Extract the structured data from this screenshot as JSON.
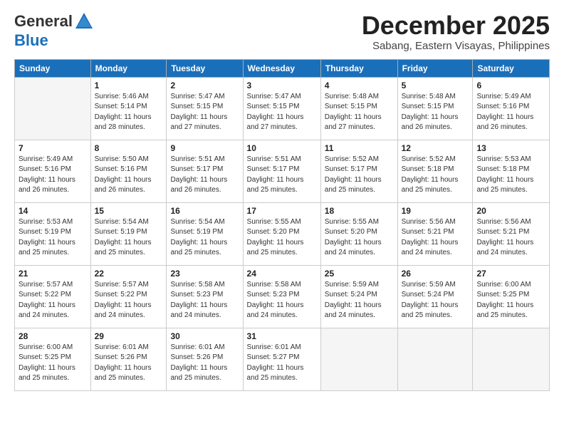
{
  "header": {
    "logo_general": "General",
    "logo_blue": "Blue",
    "month_title": "December 2025",
    "subtitle": "Sabang, Eastern Visayas, Philippines"
  },
  "weekdays": [
    "Sunday",
    "Monday",
    "Tuesday",
    "Wednesday",
    "Thursday",
    "Friday",
    "Saturday"
  ],
  "weeks": [
    [
      {
        "day": "",
        "detail": ""
      },
      {
        "day": "1",
        "detail": "Sunrise: 5:46 AM\nSunset: 5:14 PM\nDaylight: 11 hours\nand 28 minutes."
      },
      {
        "day": "2",
        "detail": "Sunrise: 5:47 AM\nSunset: 5:15 PM\nDaylight: 11 hours\nand 27 minutes."
      },
      {
        "day": "3",
        "detail": "Sunrise: 5:47 AM\nSunset: 5:15 PM\nDaylight: 11 hours\nand 27 minutes."
      },
      {
        "day": "4",
        "detail": "Sunrise: 5:48 AM\nSunset: 5:15 PM\nDaylight: 11 hours\nand 27 minutes."
      },
      {
        "day": "5",
        "detail": "Sunrise: 5:48 AM\nSunset: 5:15 PM\nDaylight: 11 hours\nand 26 minutes."
      },
      {
        "day": "6",
        "detail": "Sunrise: 5:49 AM\nSunset: 5:16 PM\nDaylight: 11 hours\nand 26 minutes."
      }
    ],
    [
      {
        "day": "7",
        "detail": "Sunrise: 5:49 AM\nSunset: 5:16 PM\nDaylight: 11 hours\nand 26 minutes."
      },
      {
        "day": "8",
        "detail": "Sunrise: 5:50 AM\nSunset: 5:16 PM\nDaylight: 11 hours\nand 26 minutes."
      },
      {
        "day": "9",
        "detail": "Sunrise: 5:51 AM\nSunset: 5:17 PM\nDaylight: 11 hours\nand 26 minutes."
      },
      {
        "day": "10",
        "detail": "Sunrise: 5:51 AM\nSunset: 5:17 PM\nDaylight: 11 hours\nand 25 minutes."
      },
      {
        "day": "11",
        "detail": "Sunrise: 5:52 AM\nSunset: 5:17 PM\nDaylight: 11 hours\nand 25 minutes."
      },
      {
        "day": "12",
        "detail": "Sunrise: 5:52 AM\nSunset: 5:18 PM\nDaylight: 11 hours\nand 25 minutes."
      },
      {
        "day": "13",
        "detail": "Sunrise: 5:53 AM\nSunset: 5:18 PM\nDaylight: 11 hours\nand 25 minutes."
      }
    ],
    [
      {
        "day": "14",
        "detail": "Sunrise: 5:53 AM\nSunset: 5:19 PM\nDaylight: 11 hours\nand 25 minutes."
      },
      {
        "day": "15",
        "detail": "Sunrise: 5:54 AM\nSunset: 5:19 PM\nDaylight: 11 hours\nand 25 minutes."
      },
      {
        "day": "16",
        "detail": "Sunrise: 5:54 AM\nSunset: 5:19 PM\nDaylight: 11 hours\nand 25 minutes."
      },
      {
        "day": "17",
        "detail": "Sunrise: 5:55 AM\nSunset: 5:20 PM\nDaylight: 11 hours\nand 25 minutes."
      },
      {
        "day": "18",
        "detail": "Sunrise: 5:55 AM\nSunset: 5:20 PM\nDaylight: 11 hours\nand 24 minutes."
      },
      {
        "day": "19",
        "detail": "Sunrise: 5:56 AM\nSunset: 5:21 PM\nDaylight: 11 hours\nand 24 minutes."
      },
      {
        "day": "20",
        "detail": "Sunrise: 5:56 AM\nSunset: 5:21 PM\nDaylight: 11 hours\nand 24 minutes."
      }
    ],
    [
      {
        "day": "21",
        "detail": "Sunrise: 5:57 AM\nSunset: 5:22 PM\nDaylight: 11 hours\nand 24 minutes."
      },
      {
        "day": "22",
        "detail": "Sunrise: 5:57 AM\nSunset: 5:22 PM\nDaylight: 11 hours\nand 24 minutes."
      },
      {
        "day": "23",
        "detail": "Sunrise: 5:58 AM\nSunset: 5:23 PM\nDaylight: 11 hours\nand 24 minutes."
      },
      {
        "day": "24",
        "detail": "Sunrise: 5:58 AM\nSunset: 5:23 PM\nDaylight: 11 hours\nand 24 minutes."
      },
      {
        "day": "25",
        "detail": "Sunrise: 5:59 AM\nSunset: 5:24 PM\nDaylight: 11 hours\nand 24 minutes."
      },
      {
        "day": "26",
        "detail": "Sunrise: 5:59 AM\nSunset: 5:24 PM\nDaylight: 11 hours\nand 25 minutes."
      },
      {
        "day": "27",
        "detail": "Sunrise: 6:00 AM\nSunset: 5:25 PM\nDaylight: 11 hours\nand 25 minutes."
      }
    ],
    [
      {
        "day": "28",
        "detail": "Sunrise: 6:00 AM\nSunset: 5:25 PM\nDaylight: 11 hours\nand 25 minutes."
      },
      {
        "day": "29",
        "detail": "Sunrise: 6:01 AM\nSunset: 5:26 PM\nDaylight: 11 hours\nand 25 minutes."
      },
      {
        "day": "30",
        "detail": "Sunrise: 6:01 AM\nSunset: 5:26 PM\nDaylight: 11 hours\nand 25 minutes."
      },
      {
        "day": "31",
        "detail": "Sunrise: 6:01 AM\nSunset: 5:27 PM\nDaylight: 11 hours\nand 25 minutes."
      },
      {
        "day": "",
        "detail": ""
      },
      {
        "day": "",
        "detail": ""
      },
      {
        "day": "",
        "detail": ""
      }
    ]
  ]
}
